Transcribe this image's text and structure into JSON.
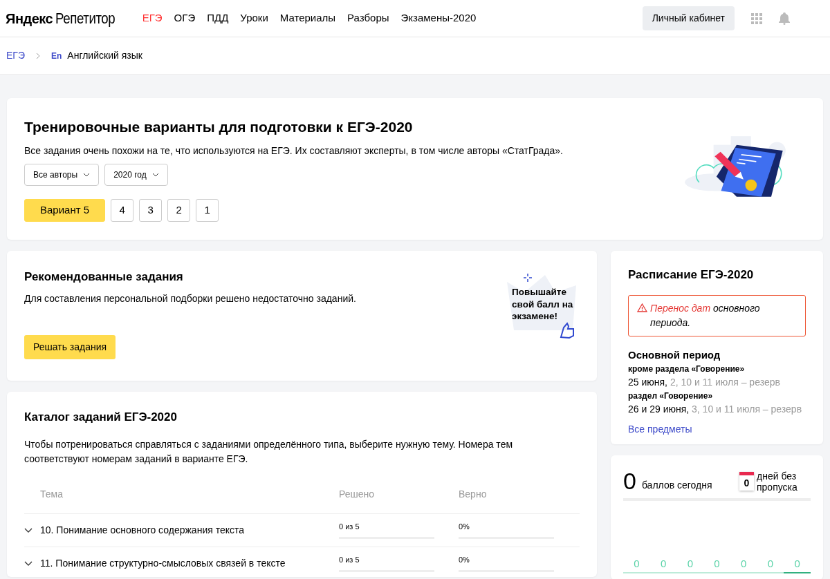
{
  "header": {
    "logo": {
      "brand": "Яндекс",
      "product": "Репетитор"
    },
    "tabs": [
      {
        "label": "ЕГЭ",
        "selected": true
      },
      {
        "label": "ОГЭ",
        "selected": false
      },
      {
        "label": "ПДД",
        "selected": false
      },
      {
        "label": "Уроки",
        "selected": false
      },
      {
        "label": "Материалы",
        "selected": false
      },
      {
        "label": "Разборы",
        "selected": false
      },
      {
        "label": "Экзамены-2020",
        "selected": false
      }
    ],
    "account_button": "Личный кабинет"
  },
  "breadcrumb": {
    "root": "ЕГЭ",
    "subject_badge": "En",
    "subject": "Английский язык"
  },
  "hero": {
    "title": "Тренировочные варианты для подготовки к ЕГЭ-2020",
    "text": "Все задания очень похожи на те, что используются на ЕГЭ. Их составляют эксперты, в том числе авторы «СтатГрада».",
    "filters": [
      "Все авторы",
      "2020 год"
    ],
    "variants": [
      {
        "label": "Вариант 5",
        "selected": true
      },
      {
        "label": "4",
        "selected": false
      },
      {
        "label": "3",
        "selected": false
      },
      {
        "label": "2",
        "selected": false
      },
      {
        "label": "1",
        "selected": false
      }
    ]
  },
  "recommended": {
    "title": "Рекомендованные задания",
    "text": "Для составления персональной подборки решено недостаточно заданий.",
    "promo": "Повышайте свой балл на экзамене!",
    "button": "Решать задания"
  },
  "catalog": {
    "title": "Каталог заданий ЕГЭ-2020",
    "text": "Чтобы потренироваться справляться с заданиями определённого типа, выберите нужную тему. Номера тем соответствуют номерам заданий в варианте ЕГЭ.",
    "columns": [
      "Тема",
      "Решено",
      "Верно"
    ],
    "rows": [
      {
        "topic": "10. Понимание основного содержания текста",
        "expanded": false,
        "solved": {
          "text": "0 из 5",
          "level": 0
        },
        "correct": {
          "text": "0%",
          "level": 0
        }
      },
      {
        "topic": "11. Понимание структурно-смысловых связей в тексте",
        "expanded": false,
        "solved": {
          "text": "0 из 5",
          "level": 0
        },
        "correct": {
          "text": "0%",
          "level": 0
        }
      }
    ]
  },
  "schedule": {
    "title": "Расписание ЕГЭ-2020",
    "alert": {
      "highlight": "Перенос дат",
      "text": "основного периода."
    },
    "period": "Основной период",
    "groups": [
      {
        "label": "кроме раздела «Говорение»",
        "dates": "25 июня,",
        "reserve": "2, 10 и 11 июля – резерв"
      },
      {
        "label": "раздел «Говорение»",
        "dates": "26 и 29 июня,",
        "reserve": "3, 10 и 11 июля – резерв"
      }
    ],
    "link": "Все предметы"
  },
  "stats": {
    "score": "0",
    "score_label": "баллов сегодня",
    "streak": "0",
    "streak_label": "дней без пропуска",
    "days": [
      {
        "value": "0",
        "selected": false
      },
      {
        "value": "0",
        "selected": false
      },
      {
        "value": "0",
        "selected": false
      },
      {
        "value": "0",
        "selected": false
      },
      {
        "value": "0",
        "selected": false
      },
      {
        "value": "0",
        "selected": false
      },
      {
        "value": "0",
        "selected": true
      }
    ]
  }
}
